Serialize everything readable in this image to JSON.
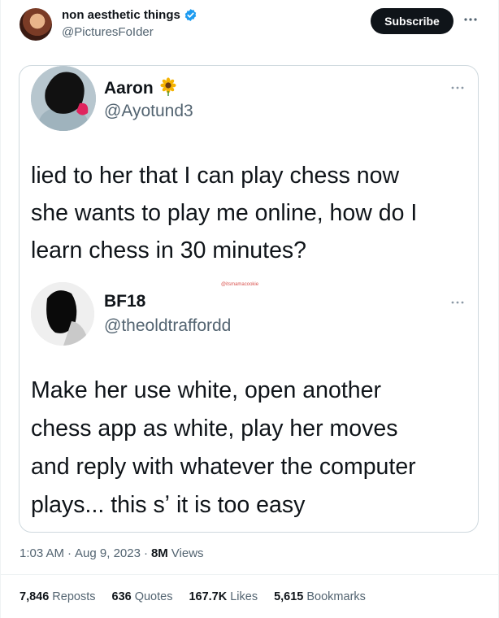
{
  "author": {
    "name": "non aesthetic things",
    "handle": "@PicturesFoIder"
  },
  "subscribe_label": "Subscribe",
  "screenshot": {
    "tweet1": {
      "name": "Aaron",
      "name_emoji": "sunflower-icon",
      "handle": "@Ayotund3",
      "lines": [
        "lied to her that I can play chess now",
        "she wants to play me online, how do I",
        "learn chess in 30 minutes?"
      ]
    },
    "watermark": "@itsmamacookie",
    "tweet2": {
      "name": "BF18",
      "handle": "@theoldtraffordd",
      "lines": [
        "Make her use white, open another",
        "chess app as white, play her moves",
        "and reply with whatever the computer",
        "plays... this sʼ it is too easy"
      ]
    }
  },
  "meta": {
    "time": "1:03 AM",
    "sep1": "·",
    "date": "Aug 9, 2023",
    "sep2": "·",
    "views_count": "8M",
    "views_label": "Views"
  },
  "stats": [
    {
      "num": "7,846",
      "label": "Reposts"
    },
    {
      "num": "636",
      "label": "Quotes"
    },
    {
      "num": "167.7K",
      "label": "Likes"
    },
    {
      "num": "5,615",
      "label": "Bookmarks"
    }
  ],
  "colors": {
    "verified": "#1d9bf0",
    "secondary_text": "#536471",
    "primary_text": "#0f1419",
    "button_bg": "#0f1419"
  }
}
